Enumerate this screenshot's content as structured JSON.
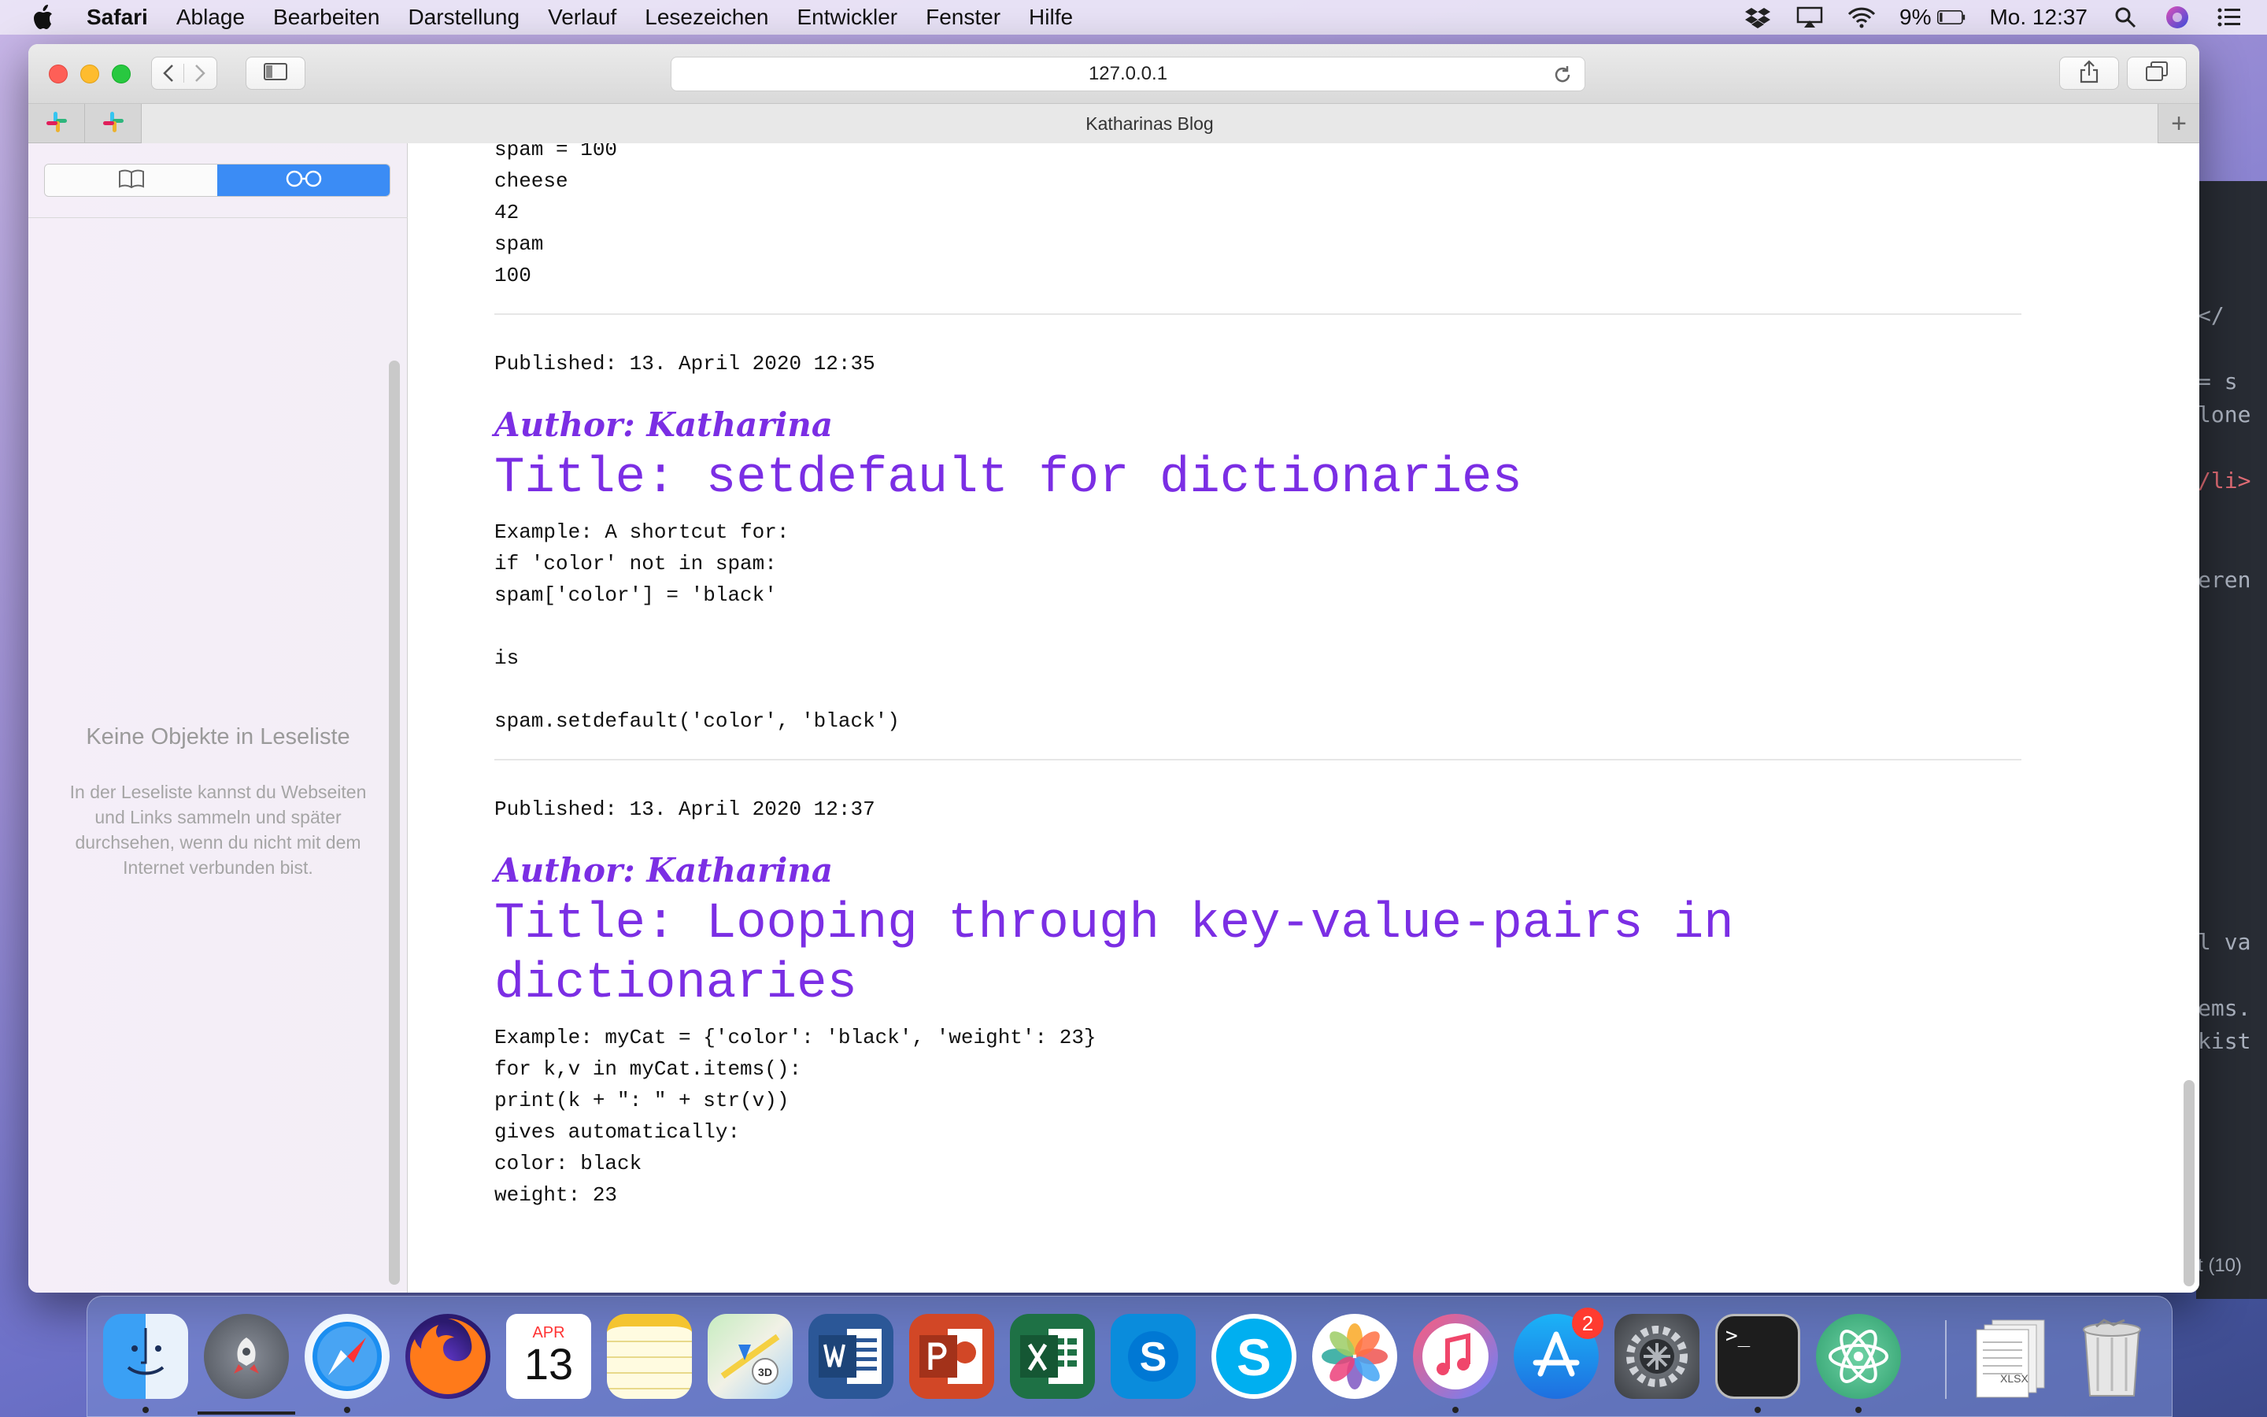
{
  "menubar": {
    "app": "Safari",
    "items": [
      "Ablage",
      "Bearbeiten",
      "Darstellung",
      "Verlauf",
      "Lesezeichen",
      "Entwickler",
      "Fenster",
      "Hilfe"
    ],
    "battery": "9%",
    "clock": "Mo. 12:37"
  },
  "toolbar": {
    "url": "127.0.0.1"
  },
  "tabs": {
    "active_title": "Katharinas Blog",
    "new_tab": "+"
  },
  "sidebar": {
    "empty_title": "Keine Objekte in Leseliste",
    "empty_description": "In der Leseliste kannst du Webseiten und Links sammeln und später durchsehen, wenn du nicht mit dem Internet verbunden bist."
  },
  "posts": [
    {
      "content": "spam = 100\ncheese\n42\nspam\n100"
    },
    {
      "published": "Published: 13. April 2020 12:35",
      "author": "Author: Katharina",
      "title": "Title: setdefault for dictionaries",
      "content": "Example: A shortcut for:\nif 'color' not in spam:\nspam['color'] = 'black'\n\nis\n\nspam.setdefault('color', 'black')"
    },
    {
      "published": "Published: 13. April 2020 12:37",
      "author": "Author: Katharina",
      "title": "Title: Looping through key-value-pairs in dictionaries",
      "content": "Example: myCat = {'color': 'black', 'weight': 23}\nfor k,v in myCat.items():\nprint(k + \": \" + str(v))\ngives automatically:\ncolor: black\nweight: 23"
    }
  ],
  "editor_background": {
    "lines": [
      "</",
      "= s",
      "lone",
      "/li>",
      "eren",
      "l va",
      "ems.",
      "kist",
      "t (10)"
    ]
  },
  "dock": {
    "calendar_month": "APR",
    "calendar_day": "13",
    "appstore_badge": "2",
    "terminal_prompt": ">_",
    "file_label": "XLSX"
  },
  "colors": {
    "accent_purple": "#7b2ee4",
    "sidebar_selected": "#3b8cf5"
  }
}
